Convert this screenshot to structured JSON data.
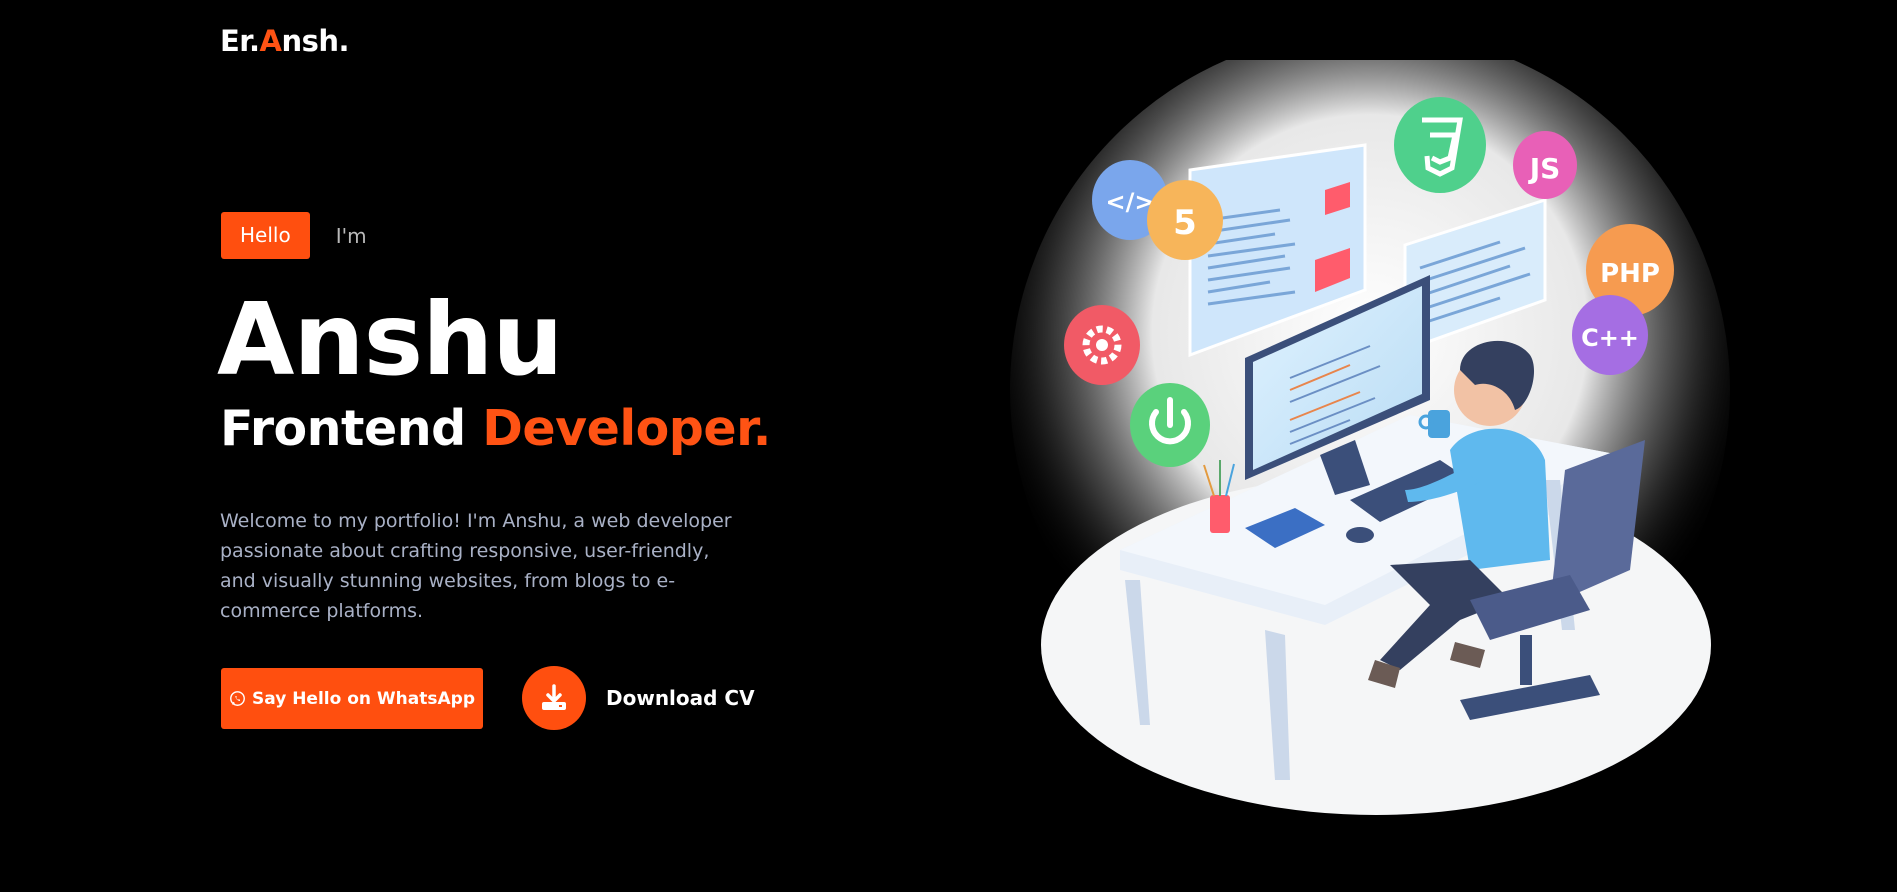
{
  "logo": {
    "prefix": "Er.",
    "accent_letter": "A",
    "suffix": "nsh."
  },
  "intro": {
    "badge": "Hello",
    "im": "I'm"
  },
  "hero": {
    "name": "Anshu",
    "role_plain": "Frontend ",
    "role_accent": "Developer."
  },
  "bio": "Welcome to my portfolio! I'm Anshu, a web developer passionate about crafting responsive, user-friendly, and visually stunning websites, from blogs to e-commerce platforms.",
  "actions": {
    "whatsapp_label": "Say Hello on WhatsApp",
    "cv_label": "Download CV"
  },
  "illustration": {
    "badges": [
      "</>",
      "5",
      "JS",
      "PHP",
      "C++"
    ],
    "icons": [
      "code-badge-icon",
      "html5-badge-icon",
      "css3-badge-icon",
      "js-badge-icon",
      "php-badge-icon",
      "cpp-badge-icon",
      "gear-badge-icon",
      "power-badge-icon"
    ]
  },
  "colors": {
    "accent": "#ff4f0f",
    "background": "#000000",
    "text": "#ffffff",
    "muted": "#a9b1c6"
  }
}
